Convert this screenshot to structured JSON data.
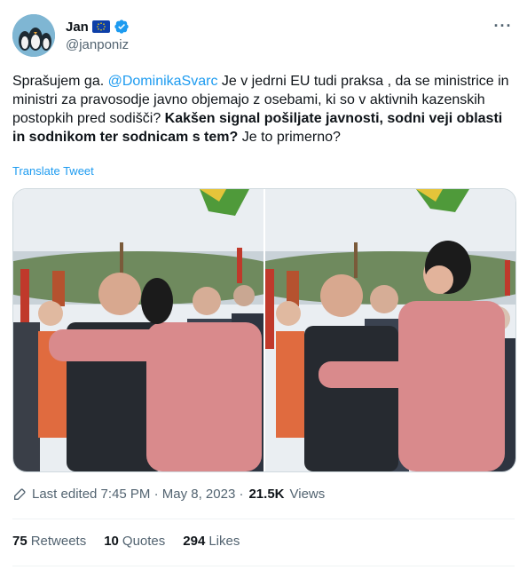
{
  "user": {
    "display_name": "Jan",
    "handle": "@janponiz",
    "flag_icon": "eu-flag-icon",
    "verified_icon": "verified-badge-icon"
  },
  "tweet": {
    "text_1": "Sprašujem ga. ",
    "mention": "@DominikaSvarc",
    "text_2": "  Je v jedrni EU tudi praksa , da se ministrice in ministri za pravosodje javno objemajo z osebami, ki so v aktivnih kazenskih postopkih pred sodišči? ",
    "text_bold": "Kakšen signal pošiljate javnosti, sodni veji oblasti in sodnikom ter sodnicam s tem?",
    "text_3": " Je to primerno?",
    "translate_label": "Translate Tweet"
  },
  "meta": {
    "edited_label": "Last edited 7:45 PM · May 8, 2023 · ",
    "views_count": "21.5K",
    "views_label": "Views"
  },
  "stats": {
    "retweets_count": "75",
    "retweets_label": "Retweets",
    "quotes_count": "10",
    "quotes_label": "Quotes",
    "likes_count": "294",
    "likes_label": "Likes"
  },
  "colors": {
    "accent": "#1d9bf0",
    "secondary_text": "#536471",
    "coat_pink": "#d98a8c"
  }
}
